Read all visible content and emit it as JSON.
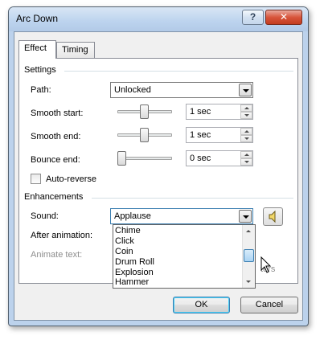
{
  "window": {
    "title": "Arc Down"
  },
  "titlebar": {
    "help_label": "?",
    "close_label": "✕"
  },
  "tabs": [
    {
      "label": "Effect"
    },
    {
      "label": "Timing"
    }
  ],
  "settings": {
    "section_label": "Settings",
    "path": {
      "label": "Path:",
      "value": "Unlocked"
    },
    "smooth_start": {
      "label": "Smooth start:",
      "value": "1 sec",
      "slider_fraction": 0.5
    },
    "smooth_end": {
      "label": "Smooth end:",
      "value": "1 sec",
      "slider_fraction": 0.5
    },
    "bounce_end": {
      "label": "Bounce end:",
      "value": "0 sec",
      "slider_fraction": 0.0
    },
    "auto_reverse": {
      "label": "Auto-reverse",
      "checked": false
    }
  },
  "enhancements": {
    "section_label": "Enhancements",
    "sound": {
      "label": "Sound:",
      "value": "Applause"
    },
    "after_animation": {
      "label": "After animation:"
    },
    "animate_text": {
      "label": "Animate text:",
      "tail": "ters"
    },
    "sound_options": [
      "Chime",
      "Click",
      "Coin",
      "Drum Roll",
      "Explosion",
      "Hammer"
    ]
  },
  "buttons": {
    "ok": "OK",
    "cancel": "Cancel"
  },
  "icons": {
    "help": "help-icon",
    "close": "close-icon",
    "speaker": "speaker-icon",
    "cursor": "mouse-cursor-icon"
  },
  "colors": {
    "accent": "#3c7fb1",
    "close_red": "#c23c1f",
    "frame": "#bcd2ec"
  }
}
